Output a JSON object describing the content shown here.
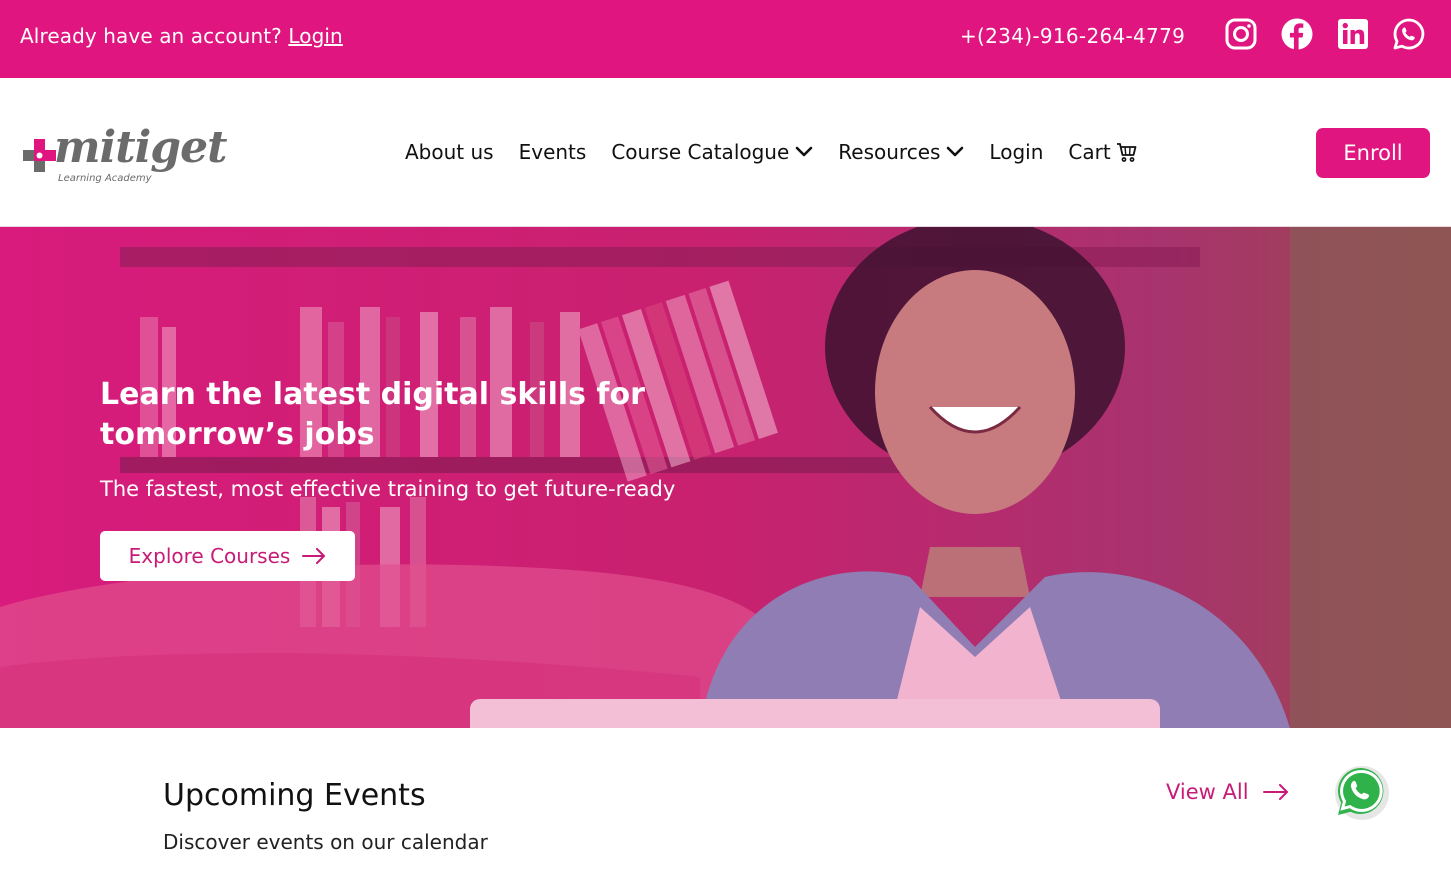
{
  "topbar": {
    "account_text": "Already have an account?",
    "login_link": "Login",
    "phone": "+(234)-916-264-4779",
    "socials": [
      "instagram-icon",
      "facebook-icon",
      "linkedin-icon",
      "whatsapp-icon"
    ],
    "background": "#e0157f"
  },
  "header": {
    "logo": {
      "wordmark": "mitiget",
      "tagline": "Learning Academy"
    },
    "nav": [
      {
        "label": "About us"
      },
      {
        "label": "Events"
      },
      {
        "label": "Course Catalogue",
        "icon": "chevron-down-icon"
      },
      {
        "label": "Resources",
        "icon": "chevron-down-icon"
      },
      {
        "label": "Login"
      },
      {
        "label": "Cart",
        "icon": "cart-icon"
      }
    ],
    "enroll_label": "Enroll"
  },
  "hero": {
    "headline": "Learn the latest digital skills for tomorrow’s jobs",
    "subheadline": "The fastest, most effective training to get future-ready",
    "cta_label": "Explore Courses",
    "cta_icon": "arrow-right-icon"
  },
  "events": {
    "title": "Upcoming Events",
    "subtitle": "Discover events on our calendar",
    "view_all_label": "View All"
  },
  "floating": {
    "icon": "whatsapp-float-icon"
  },
  "colors": {
    "brand_pink": "#e0157f",
    "accent_text": "#c81a77"
  }
}
